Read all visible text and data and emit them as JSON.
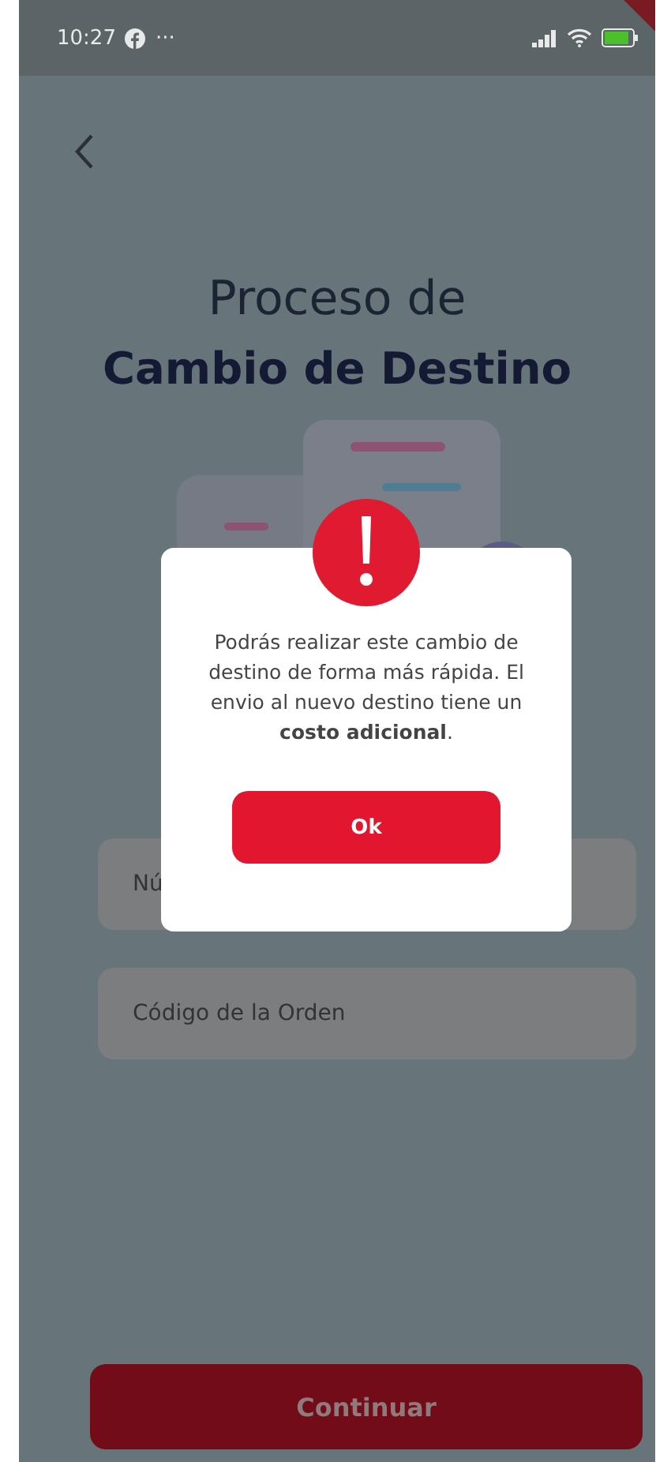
{
  "status_bar": {
    "time": "10:27",
    "more": "···"
  },
  "header": {
    "title_line_1": "Proceso de",
    "title_line_2": "Cambio de Destino"
  },
  "form": {
    "fields": [
      {
        "placeholder": "Nú"
      },
      {
        "placeholder": "Código de la Orden"
      }
    ]
  },
  "continue_button": {
    "label": "Continuar",
    "disabled": true
  },
  "dialog": {
    "message": "Podrás realizar este cambio de destino de forma más rápida. El envio al nuevo destino tiene un **costo adicional**.",
    "button": "Ok"
  }
}
